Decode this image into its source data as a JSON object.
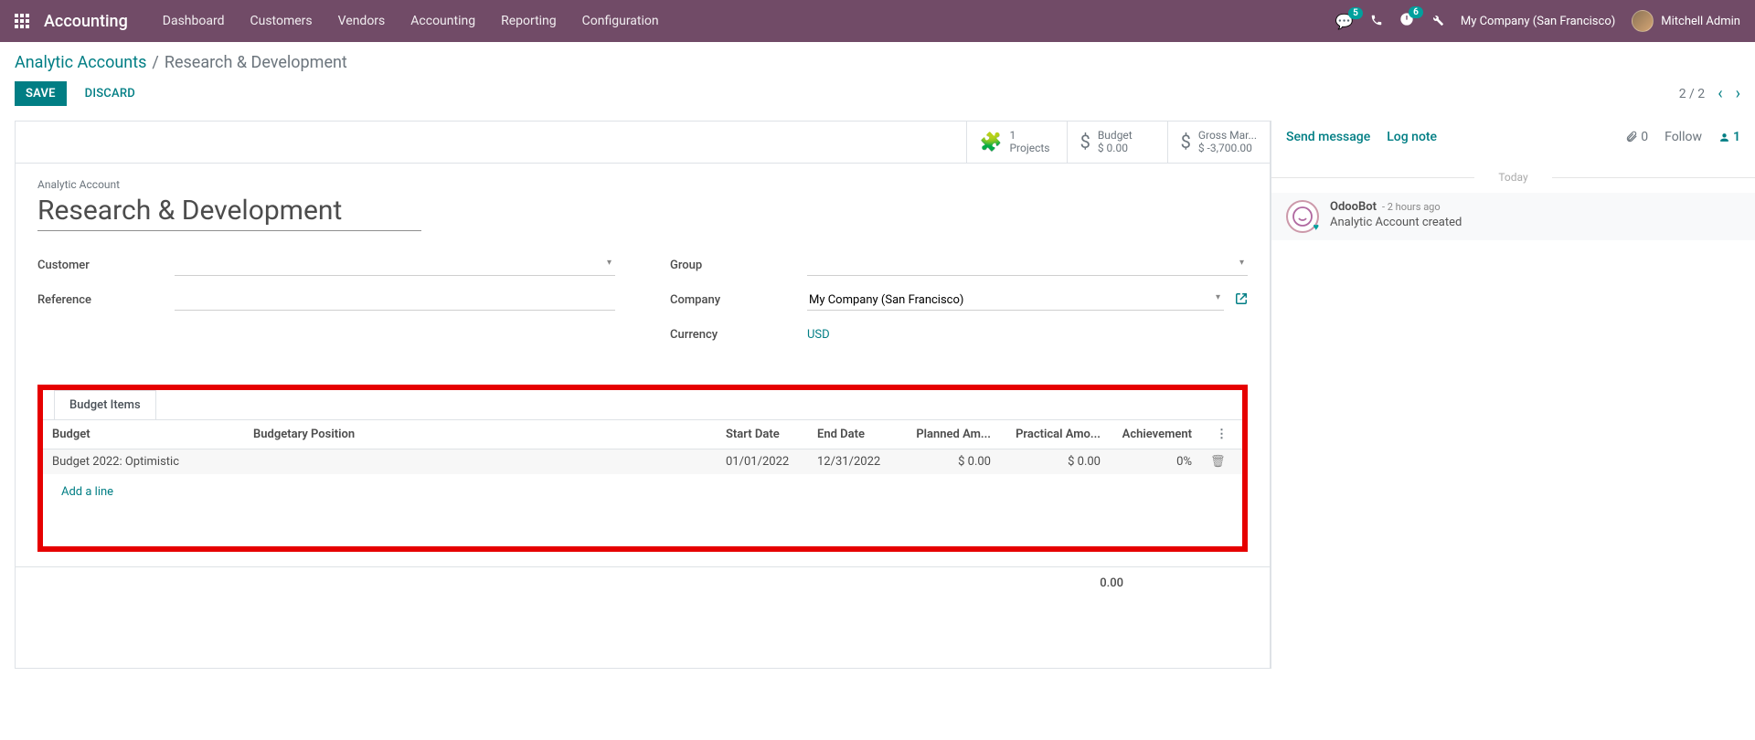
{
  "navbar": {
    "app_title": "Accounting",
    "menu": [
      "Dashboard",
      "Customers",
      "Vendors",
      "Accounting",
      "Reporting",
      "Configuration"
    ],
    "messages_badge": "5",
    "activities_badge": "6",
    "company": "My Company (San Francisco)",
    "user": "Mitchell Admin"
  },
  "breadcrumb": {
    "parent": "Analytic Accounts",
    "current": "Research & Development"
  },
  "buttons": {
    "save": "SAVE",
    "discard": "DISCARD"
  },
  "pager": {
    "text": "2 / 2"
  },
  "stats": {
    "projects": {
      "value": "1",
      "label": "Projects"
    },
    "budget": {
      "label": "Budget",
      "value": "$ 0.00"
    },
    "gross": {
      "label": "Gross Mar...",
      "value": "$ -3,700.00"
    }
  },
  "form": {
    "title_label": "Analytic Account",
    "title_value": "Research & Development",
    "labels": {
      "customer": "Customer",
      "reference": "Reference",
      "group": "Group",
      "company": "Company",
      "currency": "Currency"
    },
    "values": {
      "customer": "",
      "reference": "",
      "group": "",
      "company": "My Company (San Francisco)",
      "currency": "USD"
    }
  },
  "tabs": {
    "budget_items": "Budget Items"
  },
  "table": {
    "headers": {
      "budget": "Budget",
      "position": "Budgetary Position",
      "start": "Start Date",
      "end": "End Date",
      "planned": "Planned Am...",
      "practical": "Practical Amo...",
      "achievement": "Achievement"
    },
    "row": {
      "budget": "Budget 2022: Optimistic",
      "position": "",
      "start": "01/01/2022",
      "end": "12/31/2022",
      "planned": "$ 0.00",
      "practical": "$ 0.00",
      "achievement": "0%"
    },
    "add_line": "Add a line",
    "footer_total": "0.00"
  },
  "chatter": {
    "send": "Send message",
    "log": "Log note",
    "attach_count": "0",
    "follow": "Follow",
    "followers_count": "1",
    "day": "Today",
    "msg": {
      "author": "OdooBot",
      "time": "- 2 hours ago",
      "text": "Analytic Account created"
    }
  }
}
